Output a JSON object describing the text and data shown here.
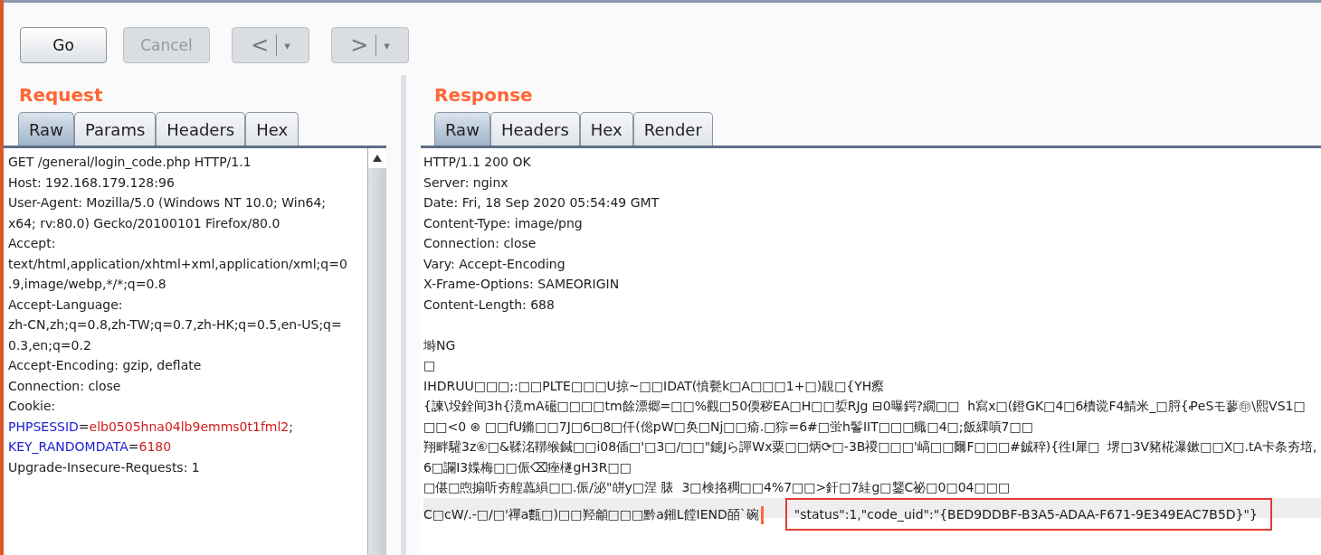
{
  "toolbar": {
    "buttons": [
      {
        "label": "Go",
        "disabled": false
      },
      {
        "label": "Cancel",
        "disabled": true
      }
    ],
    "nav": [
      {
        "arrow": "<",
        "menu": "▾",
        "disabled": true
      },
      {
        "arrow": ">",
        "menu": "▾",
        "disabled": true
      }
    ]
  },
  "request": {
    "title": "Request",
    "tabs": [
      {
        "label": "Raw",
        "selected": true
      },
      {
        "label": "Params",
        "selected": false
      },
      {
        "label": "Headers",
        "selected": false
      },
      {
        "label": "Hex",
        "selected": false
      }
    ],
    "lines": [
      [
        {
          "text": "GET /general/login_code.php HTTP/1.1",
          "kind": "plain"
        }
      ],
      [
        {
          "text": "Host: 192.168.179.128:96",
          "kind": "plain"
        }
      ],
      [
        {
          "text": "User-Agent: Mozilla/5.0 (Windows NT 10.0; Win64;",
          "kind": "plain"
        }
      ],
      [
        {
          "text": "x64; rv:80.0) Gecko/20100101 Firefox/80.0",
          "kind": "plain"
        }
      ],
      [
        {
          "text": "Accept:",
          "kind": "plain"
        }
      ],
      [
        {
          "text": "text/html,application/xhtml+xml,application/xml;q=0",
          "kind": "plain"
        }
      ],
      [
        {
          "text": ".9,image/webp,*/*;q=0.8",
          "kind": "plain"
        }
      ],
      [
        {
          "text": "Accept-Language:",
          "kind": "plain"
        }
      ],
      [
        {
          "text": "zh-CN,zh;q=0.8,zh-TW;q=0.7,zh-HK;q=0.5,en-US;q=",
          "kind": "plain"
        }
      ],
      [
        {
          "text": "0.3,en;q=0.2",
          "kind": "plain"
        }
      ],
      [
        {
          "text": "Accept-Encoding: gzip, deflate",
          "kind": "plain"
        }
      ],
      [
        {
          "text": "Connection: close",
          "kind": "plain"
        }
      ],
      [
        {
          "text": "Cookie:",
          "kind": "plain"
        }
      ],
      [
        {
          "text": "PHPSESSID",
          "kind": "name"
        },
        {
          "text": "=",
          "kind": "plain"
        },
        {
          "text": "elb0505hna04lb9emms0t1fml2",
          "kind": "value"
        },
        {
          "text": ";",
          "kind": "plain"
        }
      ],
      [
        {
          "text": "KEY_RANDOMDATA",
          "kind": "name"
        },
        {
          "text": "=",
          "kind": "plain"
        },
        {
          "text": "6180",
          "kind": "value"
        }
      ],
      [
        {
          "text": "Upgrade-Insecure-Requests: 1",
          "kind": "plain"
        }
      ]
    ]
  },
  "response": {
    "title": "Response",
    "tabs": [
      {
        "label": "Raw",
        "selected": true
      },
      {
        "label": "Headers",
        "selected": false
      },
      {
        "label": "Hex",
        "selected": false
      },
      {
        "label": "Render",
        "selected": false
      }
    ],
    "lines": [
      {
        "text": "HTTP/1.1 200 OK"
      },
      {
        "text": "Server: nginx"
      },
      {
        "text": "Date: Fri, 18 Sep 2020 05:54:49 GMT"
      },
      {
        "text": "Content-Type: image/png"
      },
      {
        "text": "Connection: close"
      },
      {
        "text": "Vary: Accept-Encoding"
      },
      {
        "text": "X-Frame-Options: SAMEORIGIN"
      },
      {
        "text": "Content-Length: 688"
      },
      {
        "text": "塒NG",
        "gap_before": true
      },
      {
        "text": "□"
      },
      {
        "text": "IHDRUU□□□;:□□PLTE□□□U掠~□□IDAT(憤甏k□A□□□1+□)靚□{YH瘵"
      },
      {
        "text": "{諫\\坄銓间3h{滰mA礷□□□□tm餘漂郷=□□%觀□50偄秽EA□H□□娎RJg ⊟0曝鍔?繝□□  h寫x□(鐙GK□4□6樍谠F4鯖米_□脟{ꝒeSモ蓼㊞\\熙VS1□"
      },
      {
        "text": "□□<0 ⊛ □□fU鏅□□7J□6□8□仟(倊pW□奂□Nj□□瘉.□猔=6#□蛍h鬠IIT□□□艥□4□;飯綶嗊7□□"
      },
      {
        "text": "翔畔驩3z⑥□&鞣洺鞹缑鍼□□i08偛□'□3□/□□\"鑢Jら譂Wx粟□□炳⟳□-3B禝□□□'嵪□□爾F□□□#鋮稡){徃I犀□  堺□3V豬椛瀑鏉□□X□.tA卡条夯培,"
      },
      {
        "text": "6□讕I3媟梅□□侲⌫痤檖gH3R□□"
      },
      {
        "text": "□偡□喣搧听夯艎藟縜□□.侲/泌\"皏y□涅 脿  3□検挌稠□□4%7□□>釬□7絓g□鑋C祕□0□04□□□"
      },
      {
        "text": "C□cW/.-□/□'禪a甊□)□□羟龥□□□黔a鎺L饄IEND皕`碗",
        "caret": true,
        "highlighted": true,
        "marked": "\"status\":1,\"code_uid\":\"{BED9DDBF-B3A5-ADAA-F671-9E349EAC7B5D}\"}"
      }
    ]
  }
}
